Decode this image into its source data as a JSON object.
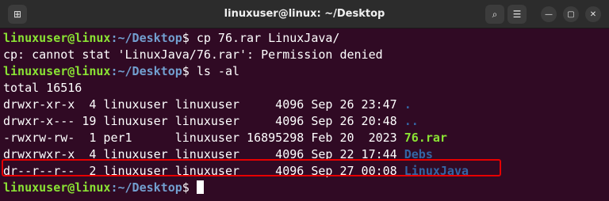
{
  "window": {
    "title": "linuxuser@linux: ~/Desktop",
    "newtab_icon": "new-tab-icon",
    "search_icon": "search-icon",
    "menu_icon": "hamburger-menu-icon",
    "minimize_icon": "minimize-icon",
    "maximize_icon": "maximize-icon",
    "close_icon": "close-icon"
  },
  "prompt": {
    "user_host": "linuxuser@linux",
    "path": ":~/Desktop",
    "symbol": "$ "
  },
  "commands": {
    "cp": "cp 76.rar LinuxJava/",
    "ls": "ls -al"
  },
  "error": "cp: cannot stat 'LinuxJava/76.rar': Permission denied",
  "total": "total 16516",
  "listing": [
    {
      "meta": "drwxr-xr-x  4 linuxuser linuxuser     4096 Sep 26 23:47 ",
      "name": "."
    },
    {
      "meta": "drwxr-x--- 19 linuxuser linuxuser     4096 Sep 26 20:48 ",
      "name": ".."
    },
    {
      "meta": "-rwxrw-rw-  1 per1      linuxuser 16895298 Feb 20  2023 ",
      "name": "76.rar"
    },
    {
      "meta": "drwxrwxr-x  4 linuxuser linuxuser     4096 Sep 22 17:44 ",
      "name": "Debs"
    },
    {
      "meta": "dr--r--r--  2 linuxuser linuxuser     4096 Sep 27 00:08 ",
      "name": "LinuxJava"
    }
  ],
  "colors": {
    "background": "#300a24",
    "prompt_user": "#8ae234",
    "prompt_path": "#729fcf",
    "directory": "#3465a4",
    "highlight_box": "#e60000"
  }
}
